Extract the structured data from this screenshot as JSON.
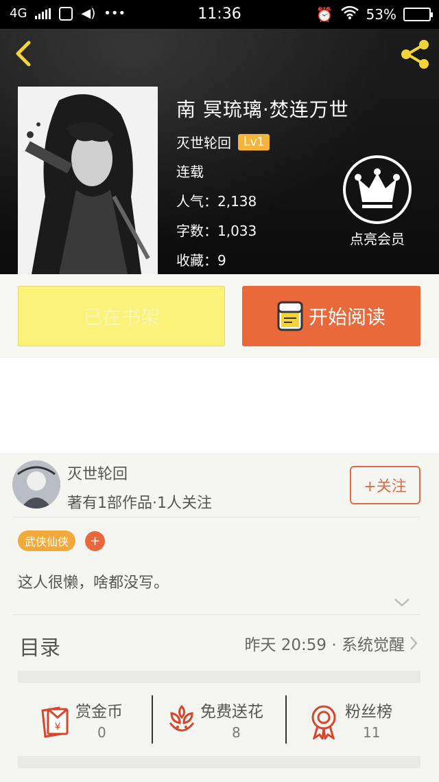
{
  "status_bar": {
    "network": "4G",
    "time": "11:36",
    "battery": "53%"
  },
  "book": {
    "title": "南 冥琉璃·焚连万世",
    "author": "灭世轮回",
    "level": "Lv1",
    "status": "连载",
    "popularity": "人气：2,138",
    "word_count": "字数：1,033",
    "favorites": "收藏：9"
  },
  "vip": {
    "label": "点亮会员"
  },
  "actions": {
    "shelf_label": "已在书架",
    "read_label": "开始阅读"
  },
  "author_card": {
    "name": "灭世轮回",
    "info": "著有1部作品·1人关注",
    "follow_label": "+关注",
    "tag": "武侠仙侠",
    "tag_add": "+",
    "bio": "这人很懒，啥都没写。"
  },
  "toc": {
    "title": "目录",
    "latest": "昨天 20:59 · 系统觉醒"
  },
  "stats": [
    {
      "label": "赏金币",
      "value": "0",
      "icon": "red-envelope-icon"
    },
    {
      "label": "免费送花",
      "value": "8",
      "icon": "flower-icon"
    },
    {
      "label": "粉丝榜",
      "value": "11",
      "icon": "medal-icon"
    }
  ],
  "colors": {
    "accent_orange": "#e9693a",
    "shelf_yellow": "#fbf27a",
    "icon_yellow": "#f5d43a",
    "level_badge": "#f5b33a",
    "icon_red": "#d9452b"
  }
}
